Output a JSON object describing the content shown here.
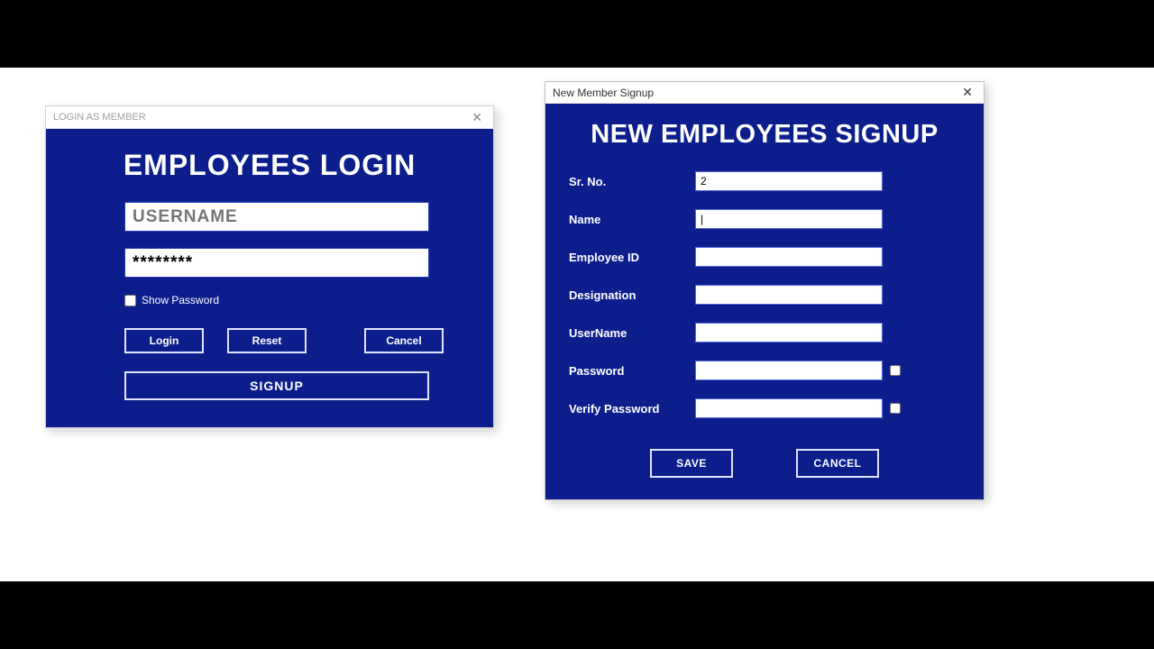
{
  "login": {
    "window_title": "LOGIN AS MEMBER",
    "heading": "EMPLOYEES LOGIN",
    "username_placeholder": "USERNAME",
    "password_masked": "********",
    "show_password_label": "Show Password",
    "btn_login": "Login",
    "btn_reset": "Reset",
    "btn_cancel": "Cancel",
    "btn_signup": "SIGNUP"
  },
  "signup": {
    "window_title": "New Member Signup",
    "heading": "NEW EMPLOYEES SIGNUP",
    "labels": {
      "sr_no": "Sr. No.",
      "name": "Name",
      "employee_id": "Employee ID",
      "designation": "Designation",
      "username": "UserName",
      "password": "Password",
      "verify_password": "Verify Password"
    },
    "values": {
      "sr_no": "2",
      "name": "|",
      "employee_id": "",
      "designation": "",
      "username": "",
      "password": "",
      "verify_password": ""
    },
    "btn_save": "SAVE",
    "btn_cancel": "CANCEL"
  }
}
